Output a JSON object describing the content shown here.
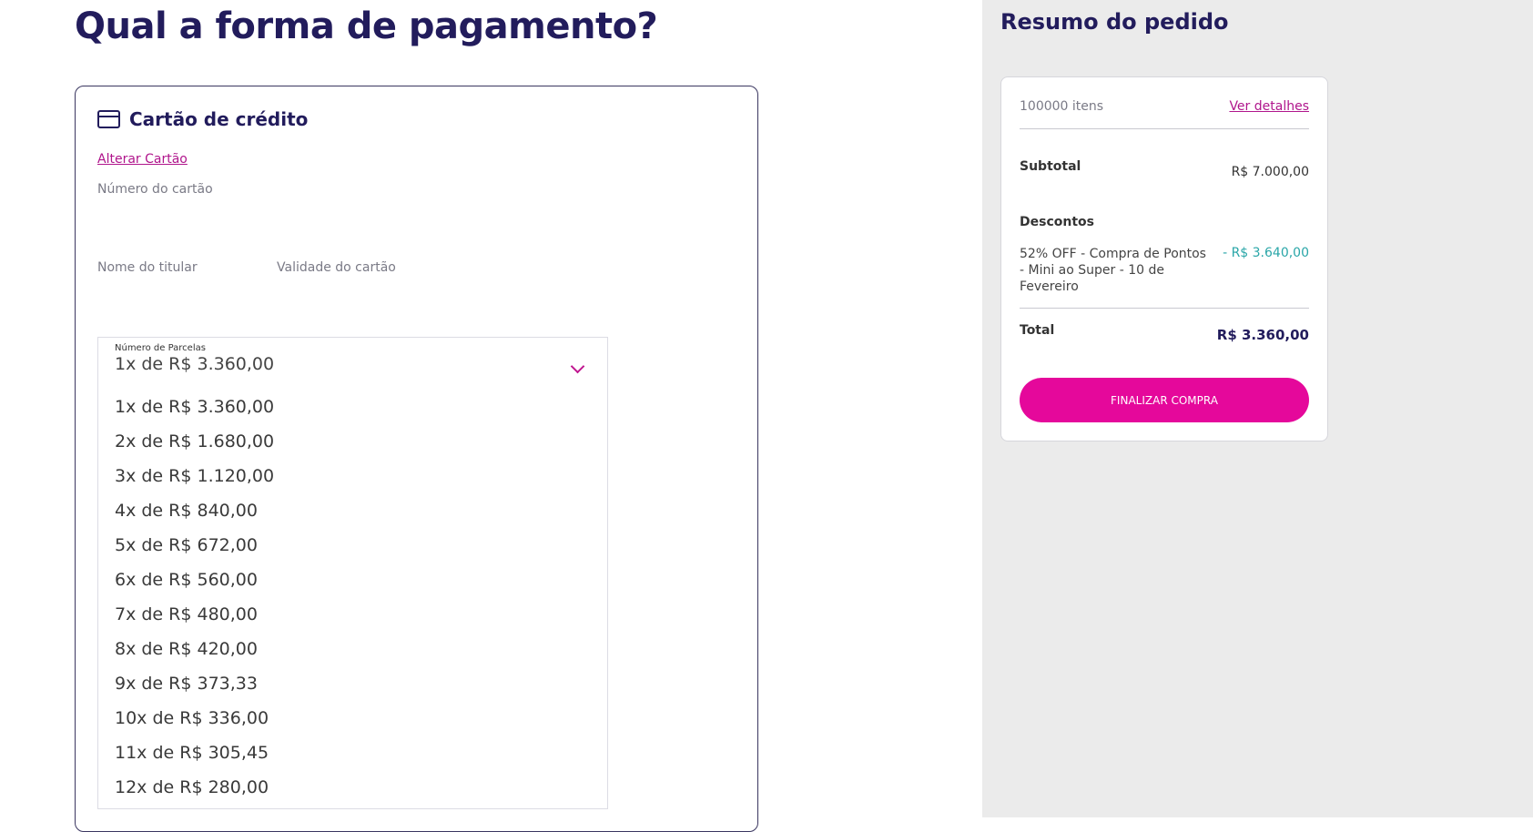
{
  "page": {
    "title": "Qual a forma de pagamento?"
  },
  "payment": {
    "title": "Cartão de crédito",
    "icon": "credit-card-icon",
    "change_card_label": "Alterar Cartão",
    "card_number_label": "Número do cartão",
    "holder_name_label": "Nome do titular",
    "expiry_label": "Validade do cartão",
    "installments": {
      "caption": "Número de Parcelas",
      "selected": "1x de R$ 3.360,00",
      "options": [
        "1x de R$ 3.360,00",
        "2x de R$ 1.680,00",
        "3x de R$ 1.120,00",
        "4x de R$ 840,00",
        "5x de R$ 672,00",
        "6x de R$ 560,00",
        "7x de R$ 480,00",
        "8x de R$ 420,00",
        "9x de R$ 373,33",
        "10x de R$ 336,00",
        "11x de R$ 305,45",
        "12x de R$ 280,00"
      ]
    }
  },
  "summary": {
    "title": "Resumo do pedido",
    "items_count": "100000 itens",
    "details_link": "Ver detalhes",
    "subtotal_label": "Subtotal",
    "subtotal_value": "R$ 7.000,00",
    "discounts_label": "Descontos",
    "discount_description": "52% OFF - Compra de Pontos - Mini ao Super - 10 de Fevereiro",
    "discount_value": "- R$ 3.640,00",
    "total_label": "Total",
    "total_value": "R$ 3.360,00",
    "finish_button_label": "FINALIZAR COMPRA"
  },
  "colors": {
    "brand_dark": "#221c5c",
    "brand_pink": "#e5089b",
    "link_pink": "#b0158c",
    "discount_teal": "#2aa6a8",
    "panel_gray": "#ebebeb"
  }
}
